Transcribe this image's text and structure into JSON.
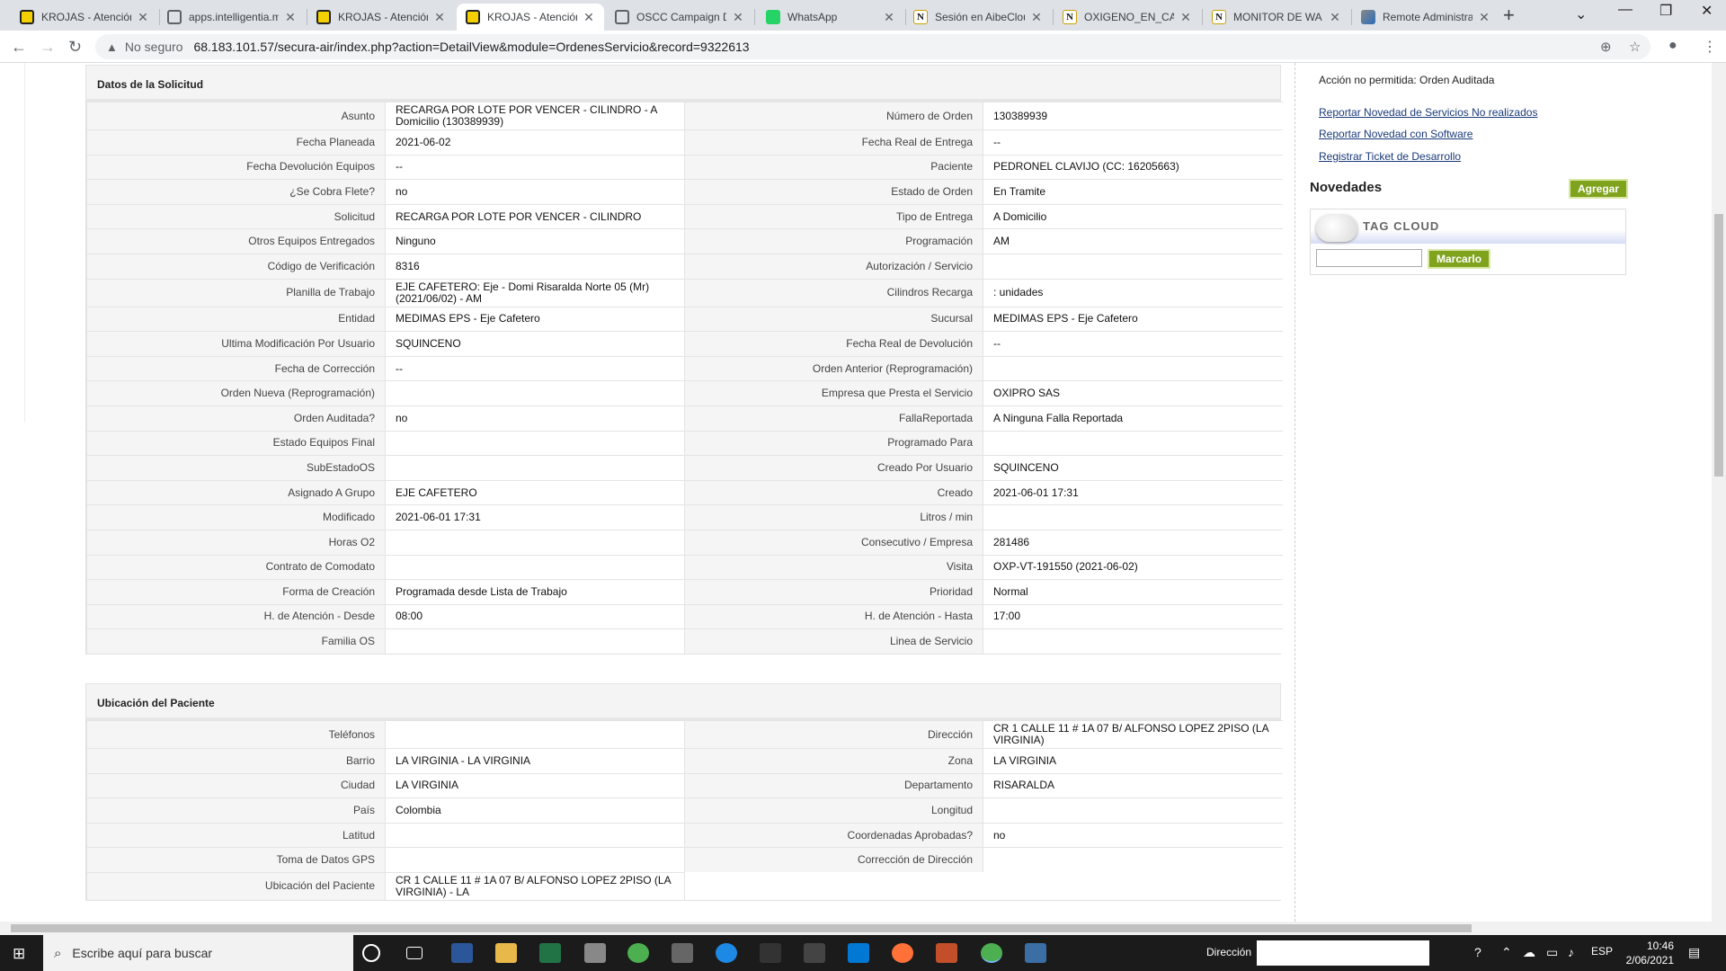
{
  "browser": {
    "tabs": [
      {
        "title": "KROJAS - Atención",
        "icon": "krojas-icon"
      },
      {
        "title": "apps.intelligentia.m",
        "icon": "globe-icon"
      },
      {
        "title": "KROJAS - Atención",
        "icon": "krojas-icon"
      },
      {
        "title": "KROJAS - Atención",
        "icon": "krojas-icon",
        "active": true
      },
      {
        "title": "OSCC Campaign D",
        "icon": "globe-icon"
      },
      {
        "title": "WhatsApp",
        "icon": "whatsapp-icon"
      },
      {
        "title": "Sesión en AibeClou",
        "icon": "n-icon"
      },
      {
        "title": "OXIGENO_EN_CAS",
        "icon": "n-icon"
      },
      {
        "title": "MONITOR DE WA I",
        "icon": "n-icon"
      },
      {
        "title": "Remote Administra",
        "icon": "remote-icon"
      }
    ],
    "security": "No seguro",
    "url": "68.183.101.57/secura-air/index.php?action=DetailView&module=OrdenesServicio&record=9322613"
  },
  "solicitud": {
    "title": "Datos de la Solicitud",
    "rows": [
      [
        "Asunto",
        "RECARGA POR LOTE POR VENCER - CILINDRO - A Domicilio (130389939)",
        "Número de Orden",
        "130389939"
      ],
      [
        "Fecha Planeada",
        " 2021-06-02",
        "Fecha Real de Entrega",
        "--"
      ],
      [
        "Fecha Devolución Equipos",
        "--",
        "Paciente",
        "PEDRONEL CLAVIJO (CC: 16205663)"
      ],
      [
        "¿Se Cobra Flete?",
        " no",
        "Estado de Orden",
        "En Tramite"
      ],
      [
        "Solicitud",
        "RECARGA POR LOTE POR VENCER - CILINDRO",
        "Tipo de Entrega",
        "A Domicilio"
      ],
      [
        "Otros Equipos Entregados",
        "Ninguno",
        "Programación",
        "AM"
      ],
      [
        "Código de Verificación",
        "8316",
        "Autorización / Servicio",
        ""
      ],
      [
        "Planilla de Trabajo",
        "EJE CAFETERO: Eje - Domi Risaralda Norte 05 (Mr) (2021/06/02) - AM",
        "Cilindros Recarga",
        ": unidades"
      ],
      [
        "Entidad",
        "MEDIMAS EPS - Eje Cafetero",
        "Sucursal",
        "MEDIMAS EPS - Eje Cafetero"
      ],
      [
        "Ultima Modificación Por Usuario",
        "SQUINCENO",
        "Fecha Real de Devolución",
        "--"
      ],
      [
        "Fecha de Corrección",
        "--",
        "Orden Anterior (Reprogramación)",
        ""
      ],
      [
        "Orden Nueva (Reprogramación)",
        "",
        "Empresa que Presta el Servicio",
        "OXIPRO SAS"
      ],
      [
        "Orden Auditada?",
        " no",
        "FallaReportada",
        "A Ninguna Falla Reportada"
      ],
      [
        "Estado Equipos Final",
        "",
        "Programado Para",
        ""
      ],
      [
        "SubEstadoOS",
        "",
        "Creado Por Usuario",
        "SQUINCENO"
      ],
      [
        "Asignado A Grupo",
        "EJE CAFETERO",
        "Creado",
        "2021-06-01 17:31"
      ],
      [
        "Modificado",
        "2021-06-01 17:31",
        "Litros / min",
        ""
      ],
      [
        "Horas O2",
        "",
        "Consecutivo / Empresa",
        "281486"
      ],
      [
        "Contrato de Comodato",
        "",
        "Visita",
        "OXP-VT-191550 (2021-06-02)"
      ],
      [
        "Forma de Creación",
        "Programada desde Lista de Trabajo",
        "Prioridad",
        "Normal"
      ],
      [
        "H. de Atención - Desde",
        "08:00",
        "H. de Atención - Hasta",
        "17:00"
      ],
      [
        "Familia OS",
        "",
        "Linea de Servicio",
        ""
      ]
    ]
  },
  "ubicacion": {
    "title": "Ubicación del Paciente",
    "rows": [
      [
        "Teléfonos",
        "",
        "Dirección",
        "CR 1 CALLE 11 # 1A 07 B/ ALFONSO LOPEZ 2PISO (LA VIRGINIA)"
      ],
      [
        "Barrio",
        "LA VIRGINIA - LA VIRGINIA",
        "Zona",
        "LA VIRGINIA"
      ],
      [
        "Ciudad",
        "LA VIRGINIA",
        "Departamento",
        "RISARALDA"
      ],
      [
        "País",
        "Colombia",
        "Longitud",
        ""
      ],
      [
        "Latitud",
        "",
        "Coordenadas Aprobadas?",
        " no"
      ],
      [
        "Toma de Datos GPS",
        "",
        "Corrección de Dirección",
        ""
      ],
      [
        "Ubicación del Paciente",
        "CR 1 CALLE 11 # 1A 07 B/ ALFONSO LOPEZ 2PISO (LA VIRGINIA) - LA",
        null,
        null
      ]
    ]
  },
  "sidebar": {
    "message": "Acción no permitida: Orden Auditada",
    "links": [
      "Reportar Novedad de Servicios No realizados",
      "Reportar Novedad con Software",
      "Registrar Ticket de Desarrollo"
    ],
    "novedades": "Novedades",
    "agregar": "Agregar",
    "tag_cloud": "TAG CLOUD",
    "marcarlo": "Marcarlo"
  },
  "taskbar": {
    "search_placeholder": "Escribe aquí para buscar",
    "direccion_label": "Dirección",
    "language": "ESP",
    "time": "10:46",
    "date": "2/06/2021"
  }
}
